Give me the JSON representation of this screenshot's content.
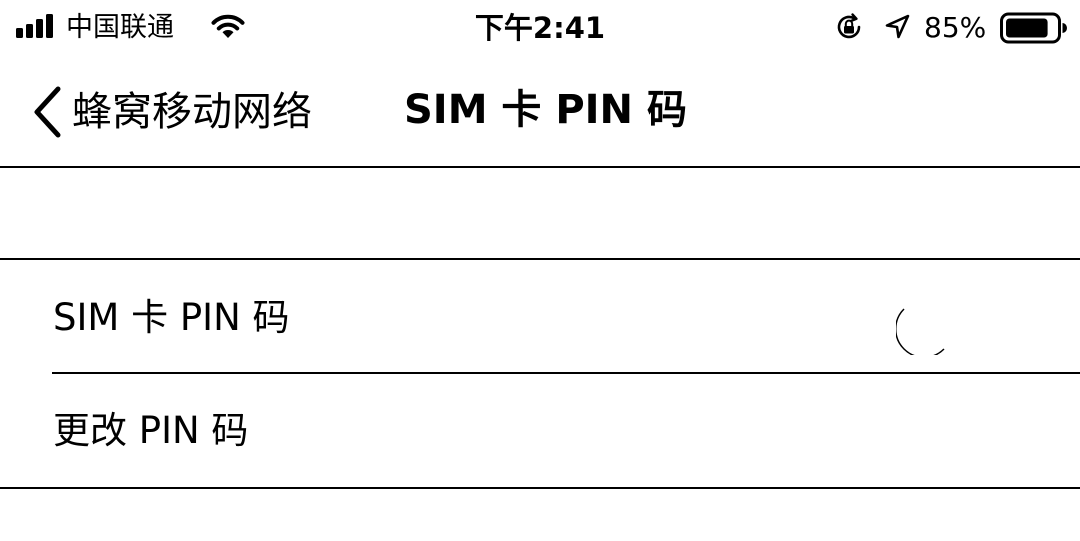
{
  "status_bar": {
    "carrier": "中国联通",
    "time": "下午2:41",
    "battery_percent": "85%",
    "battery_level": 0.85,
    "signal_bars": 4
  },
  "nav": {
    "back_label": "蜂窝移动网络",
    "title": "SIM 卡 PIN 码"
  },
  "rows": [
    {
      "label": "SIM 卡 PIN 码",
      "state": "loading"
    },
    {
      "label": "更改 PIN 码"
    }
  ],
  "icons": {
    "signal": "cellular-signal-icon",
    "wifi": "wifi-icon",
    "rotation_lock": "rotation-lock-icon",
    "location": "location-arrow-icon",
    "battery": "battery-icon",
    "back": "chevron-left-icon",
    "spinner": "loading-spinner-icon"
  }
}
